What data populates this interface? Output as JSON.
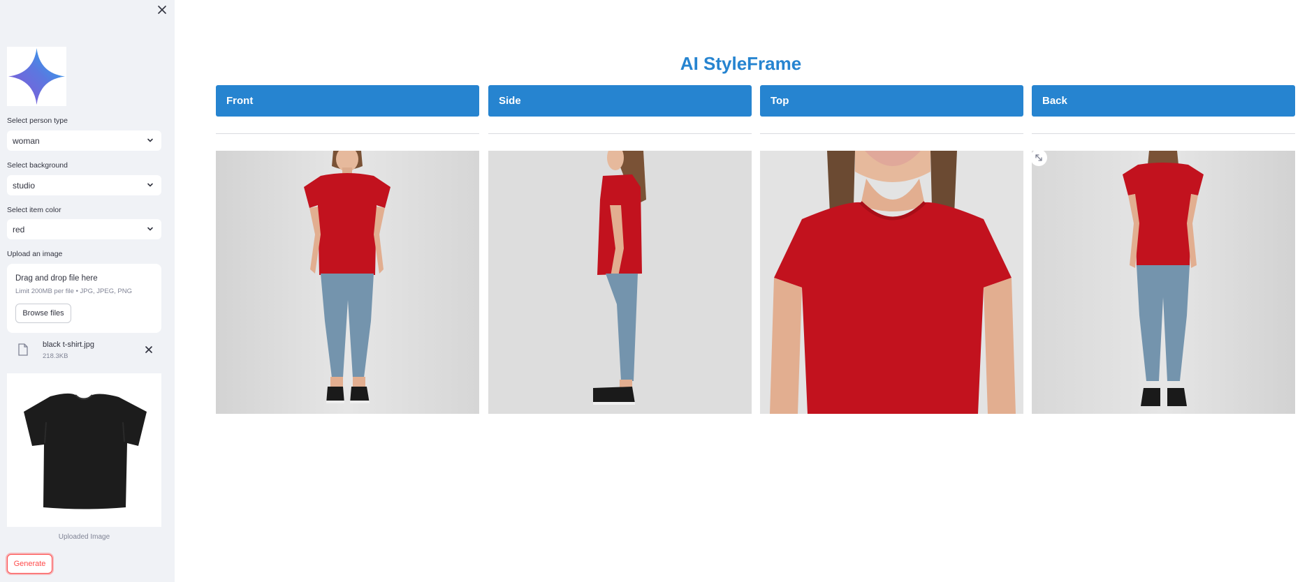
{
  "sidebar": {
    "close_icon": "close-icon",
    "logo_icon": "sparkle-star-icon",
    "person_type": {
      "label": "Select person type",
      "value": "woman"
    },
    "background": {
      "label": "Select background",
      "value": "studio"
    },
    "item_color": {
      "label": "Select item color",
      "value": "red"
    },
    "upload": {
      "label": "Upload an image",
      "dropzone_title": "Drag and drop file here",
      "dropzone_hint": "Limit 200MB per file • JPG, JPEG, PNG",
      "browse_label": "Browse files"
    },
    "file": {
      "name": "black t-shirt.jpg",
      "size": "218.3KB",
      "icon": "file-icon"
    },
    "preview_caption": "Uploaded Image",
    "generate_label": "Generate"
  },
  "main": {
    "title": "AI StyleFrame",
    "views": [
      {
        "label": "Front"
      },
      {
        "label": "Side"
      },
      {
        "label": "Top"
      },
      {
        "label": "Back"
      }
    ],
    "expand_icon": "expand-icon"
  },
  "colors": {
    "accent": "#2684d0",
    "sidebar_bg": "#f0f2f6",
    "primary_red": "#ff4b4b",
    "shirt_red": "#c2121e",
    "jeans_blue": "#6f8fa9"
  }
}
